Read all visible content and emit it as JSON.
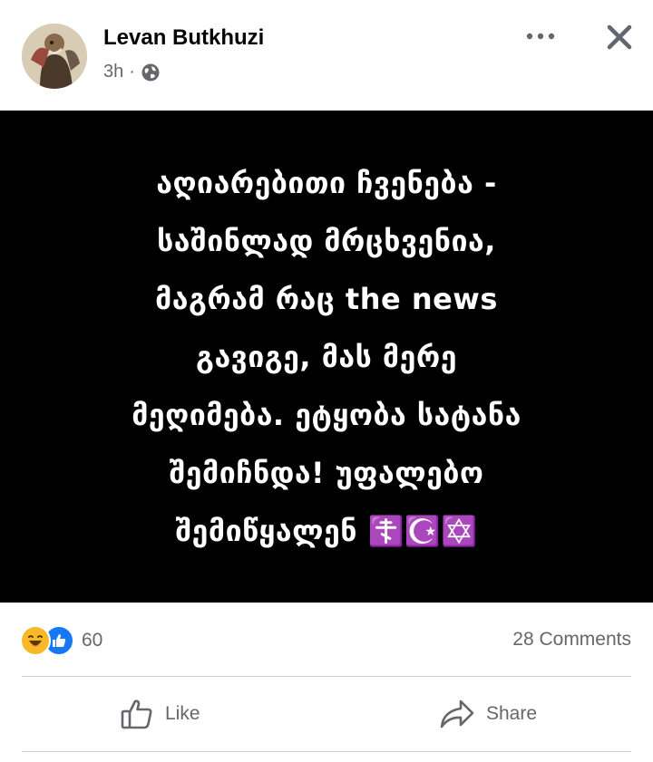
{
  "post": {
    "author": "Levan Butkhuzi",
    "time": "3h",
    "separator": "·",
    "visibility_icon": "globe-icon",
    "text": "აღიარებითი ჩვენება -\nსაშინლად მრცხვენია,\nმაგრამ რაც the news\nგავიგე, მას მერე\nმეღიმება. ეტყობა სატანა\nშემიჩნდა! უფალებო\nშემიწყალენ ☦️☪️✡️"
  },
  "reactions": {
    "icons": [
      "haha-reaction-icon",
      "like-reaction-icon"
    ],
    "count": "60",
    "comments": "28 Comments"
  },
  "actions": {
    "like": "Like",
    "share": "Share"
  },
  "colors": {
    "meta_text": "#65676b",
    "like_blue": "#1877f2",
    "haha_yellow": "#f7b928",
    "post_background": "#000000"
  }
}
